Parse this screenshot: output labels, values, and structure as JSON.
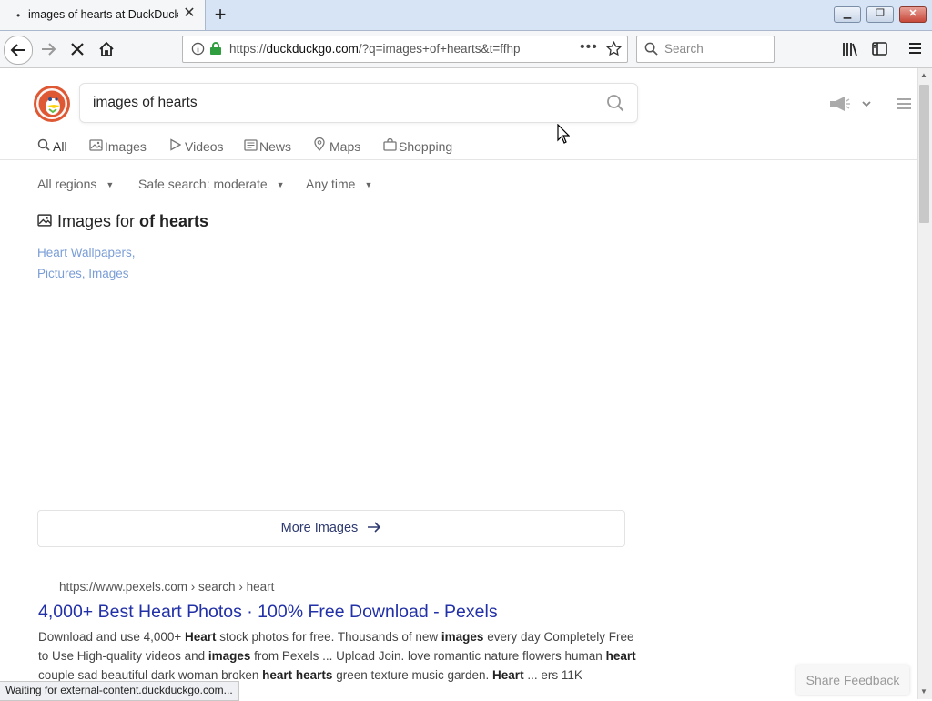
{
  "browser": {
    "tab": {
      "title": "images of hearts at DuckDuckGo",
      "loading_dot": "•"
    },
    "url": {
      "prefix": "https://",
      "domain": "duckduckgo.com",
      "path": "/?q=images+of+hearts&t=ffhp"
    },
    "search_placeholder": "Search",
    "status": "Waiting for external-content.duckduckgo.com..."
  },
  "ddg": {
    "query": "images of hearts",
    "nav": [
      "All",
      "Images",
      "Videos",
      "News",
      "Maps",
      "Shopping"
    ],
    "filters": [
      "All regions",
      "Safe search: moderate",
      "Any time"
    ],
    "images_section": {
      "title_prefix": "Images for ",
      "title_bold": "of hearts",
      "link_lines": [
        "Heart Wallpapers,",
        "Pictures, Images"
      ]
    },
    "more_images": "More Images",
    "result": {
      "url": "https://www.pexels.com › search › heart",
      "title": "4,000+ Best Heart Photos · 100% Free Download - Pexels",
      "snippet_html": "Download and use 4,000+ <b>Heart</b> stock photos for free. Thousands of new <b>images</b> every day Completely Free to Use High-quality videos and <b>images</b> from Pexels ... Upload Join. love romantic nature flowers human <b>heart</b> couple sad beautiful dark woman broken <b>heart hearts</b> green texture music garden. <b>Heart</b> ... ers 11K"
    },
    "share_feedback": "Share Feedback"
  },
  "colors": {
    "ddg_orange": "#de5833",
    "link_blue": "#2231a8",
    "accent_green": "#2e9e3e"
  }
}
